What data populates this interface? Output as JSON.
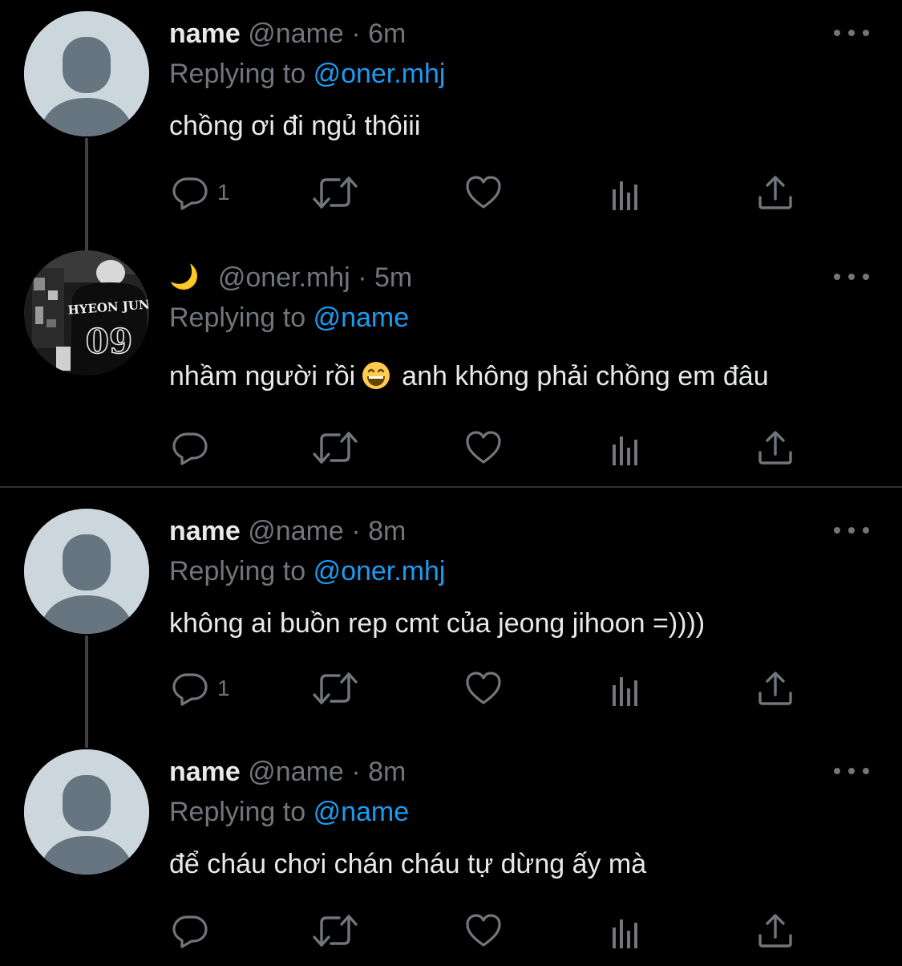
{
  "colors": {
    "background": "#000000",
    "text": "#e7e9ea",
    "muted": "#71767b",
    "mention": "#1d9bf0",
    "thread_line": "#3e4144",
    "divider": "#2f3336"
  },
  "tweets": [
    {
      "display_name": "name",
      "handle": "@name",
      "time": "6m",
      "replying_label": "Replying to",
      "replying_to": "@oner.mhj",
      "text": "chồng ơi đi ngủ thôiii",
      "reply_count": "1",
      "avatar": "default-avatar"
    },
    {
      "display_name_icon": "crescent-moon",
      "display_name_glyph": "🌙",
      "handle": "@oner.mhj",
      "time": "5m",
      "replying_label": "Replying to",
      "replying_to": "@name",
      "text_before_emoji": "nhầm người rồi",
      "emoji": "grinning-face-with-smiling-eyes",
      "text_after_emoji": "anh không phải chồng em đâu",
      "reply_count": "",
      "avatar": "photo-avatar",
      "avatar_jersey_name": "HYEON JUN",
      "avatar_jersey_number": "09"
    },
    {
      "display_name": "name",
      "handle": "@name",
      "time": "8m",
      "replying_label": "Replying to",
      "replying_to": "@oner.mhj",
      "text": "không ai buồn rep cmt của jeong jihoon =))))",
      "reply_count": "1",
      "avatar": "default-avatar"
    },
    {
      "display_name": "name",
      "handle": "@name",
      "time": "8m",
      "replying_label": "Replying to",
      "replying_to": "@name",
      "text": "để cháu chơi chán cháu tự dừng ấy mà",
      "reply_count": "",
      "avatar": "default-avatar"
    }
  ],
  "separator": "·",
  "action_icons": [
    "reply-icon",
    "retweet-icon",
    "like-icon",
    "views-icon",
    "share-icon"
  ]
}
